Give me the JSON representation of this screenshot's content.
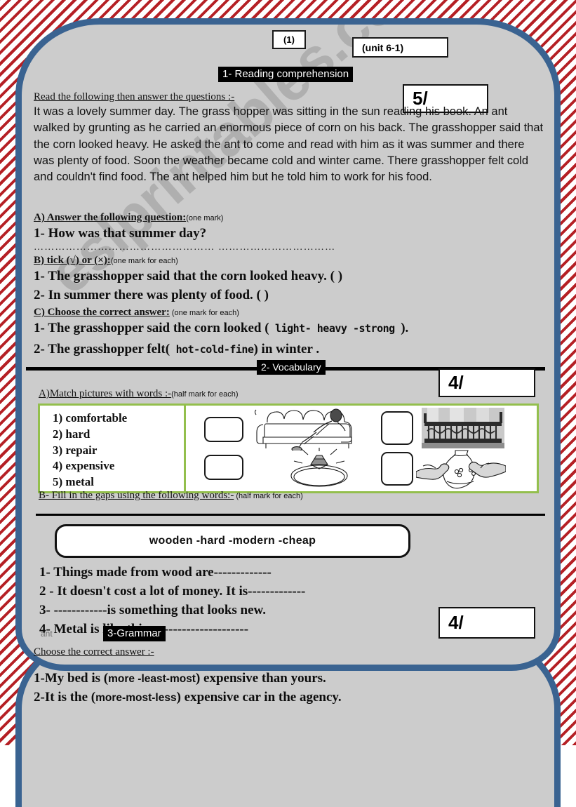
{
  "header": {
    "page_number": "(1)",
    "unit": "(unit 6-1)"
  },
  "watermark": "eslprintables.com",
  "sections": [
    {
      "id": "reading",
      "heading": "1- Reading comprehension",
      "score": "5/",
      "instruction": "Read the following then answer the questions :-",
      "passage": "It was a lovely summer day. The grass hopper was sitting in the sun reading his book. An ant walked by grunting as he carried an enormous piece of corn on his back. The grasshopper said that the corn looked heavy. He asked the ant to come and read with him as it was summer and there was plenty of food. Soon the weather became cold and winter came. There grasshopper felt cold and couldn't find food. The ant helped him but he told him to work for his food.",
      "part_a": {
        "label": "A)  Answer the following question:",
        "marks": "(one mark)",
        "question": "1- How was that summer day?",
        "answer_line": "……………………………………………  ……………………………"
      },
      "part_b": {
        "label": "B)  tick (√) or (×):",
        "marks": "(one mark  for each)",
        "items": [
          "1-  The grasshopper said that the corn looked  heavy.  (   )",
          "2-  In summer there was plenty of food. (   )"
        ]
      },
      "part_c": {
        "label": "C)  Choose the correct answer:",
        "marks": " (one mark for each)",
        "items": [
          {
            "before": "1- The grasshopper said the  corn looked (",
            "options": " light-  heavy -strong ",
            "after": ")."
          },
          {
            "before": "2- The grasshopper felt(",
            "options": " hot-cold-fine",
            "after": ") in winter ."
          }
        ]
      }
    },
    {
      "id": "vocabulary",
      "heading": "2- Vocabulary",
      "score": "4/",
      "part_a": {
        "label": "A)Match pictures with words :-",
        "marks": "(half mark for each)",
        "words": [
          "1) comfortable",
          "2) hard",
          "3)  repair",
          "4)  expensive",
          "5)  metal"
        ],
        "pictures": [
          {
            "name": "man-relaxing-on-sofa-picture",
            "alt": "man lying on a sofa"
          },
          {
            "name": "diamond-ring-picture",
            "alt": "sparkling diamond ring"
          },
          {
            "name": "metal-balcony-railing-picture",
            "alt": "wrought iron balcony railing"
          },
          {
            "name": "hands-repairing-vase-picture",
            "alt": "hands repairing a vase"
          }
        ]
      },
      "part_b": {
        "label": "B- Fill in the gaps using the following words:-",
        "marks": " (half mark for each)",
        "word_bank": "wooden  -hard   -modern   -cheap",
        "items": [
          "1- Things made from wood are-------------",
          "2 -  It doesn't cost a lot of money. It is-------------",
          "3-  ------------is something that looks new.",
          "4- Metal is like this.----------------------"
        ]
      }
    },
    {
      "id": "grammar",
      "heading": "3-Grammar",
      "score": "4/",
      "stray_text": "ant",
      "instruction": "Choose the correct answer :-",
      "items": [
        {
          "before": "1-My bed is (",
          "options": "more -least-most",
          "after": ") expensive than yours."
        },
        {
          "before": "2-It is the (",
          "options": "more-most-less",
          "after": ") expensive car in the agency."
        }
      ]
    }
  ],
  "colors": {
    "frame_blue": "#3a6391",
    "stripe_red": "#b52025",
    "page_gray": "#cccccc",
    "match_box_green": "#93bf4d"
  }
}
